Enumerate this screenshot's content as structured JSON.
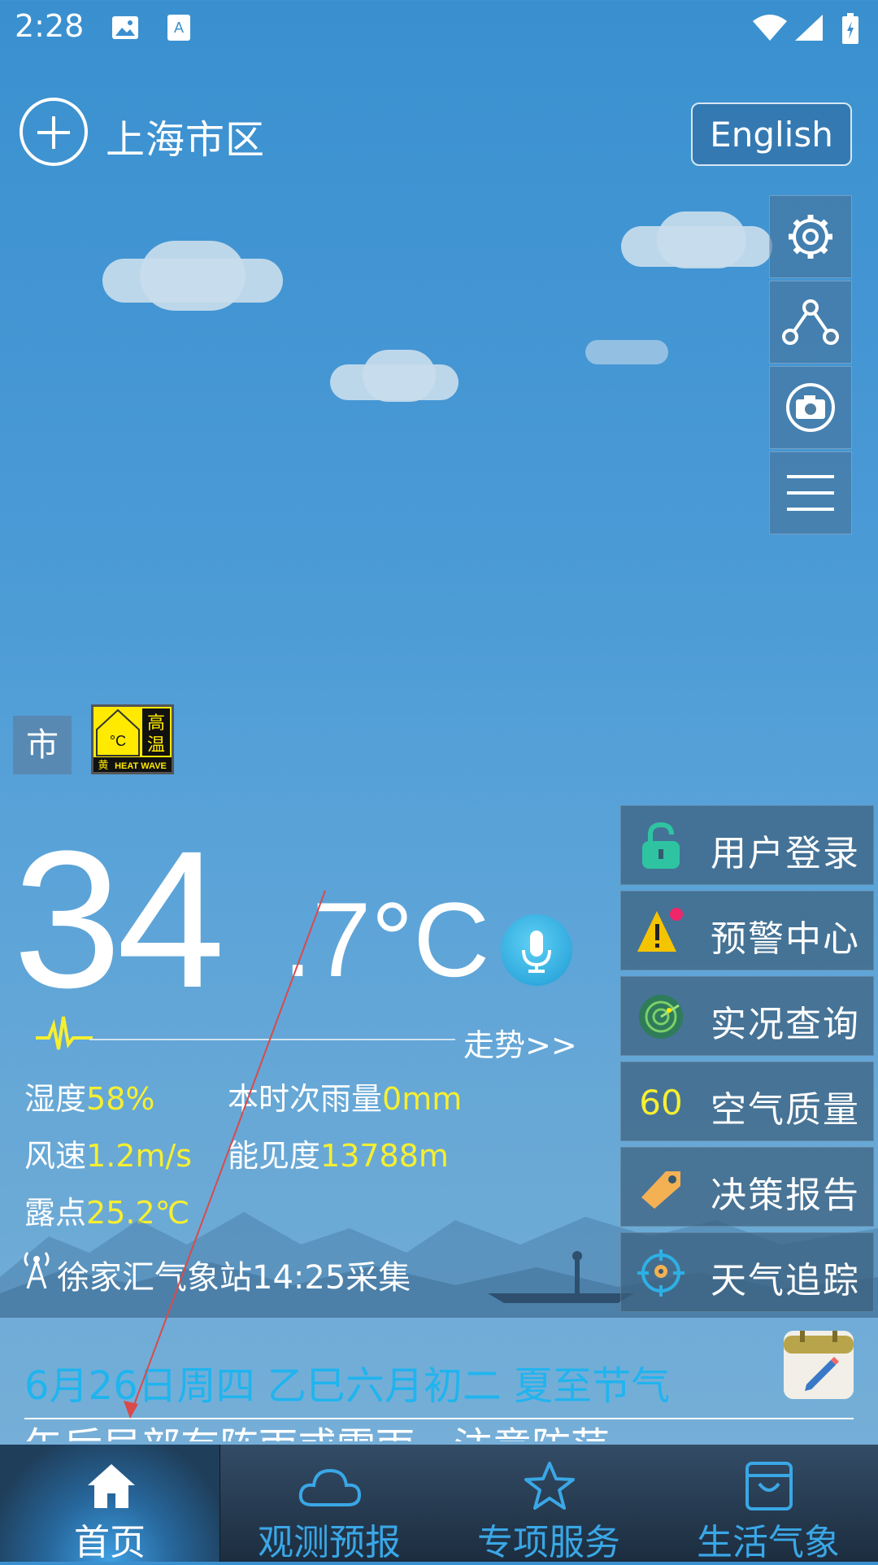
{
  "status_bar": {
    "time": "2:28"
  },
  "header": {
    "city": "上海市区",
    "language_button": "English"
  },
  "tools": [
    {
      "icon": "gear-icon"
    },
    {
      "icon": "share-icon"
    },
    {
      "icon": "camera-icon"
    },
    {
      "icon": "menu-icon"
    }
  ],
  "warning": {
    "scope": "市",
    "badge_level": "黄",
    "badge_title": "高温",
    "badge_en": "HEAT WAVE",
    "badge_unit": "°C"
  },
  "temperature": {
    "integer": "34",
    "decimal": ".7",
    "unit": "°C"
  },
  "trend_link": "走势>>",
  "observations": {
    "humidity_label": "湿度",
    "humidity_value": "58%",
    "rain_label": "本时次雨量",
    "rain_value": "0mm",
    "wind_label": "风速",
    "wind_value": "1.2m/s",
    "visibility_label": "能见度",
    "visibility_value": "13788m",
    "dew_label": "露点",
    "dew_value": "25.2℃"
  },
  "station": "徐家汇气象站14:25采集",
  "menu": [
    {
      "label": "用户登录",
      "icon": "lock-icon"
    },
    {
      "label": "预警中心",
      "icon": "warning-icon"
    },
    {
      "label": "实况查询",
      "icon": "radar-icon"
    },
    {
      "label": "空气质量",
      "icon": "aqi-value",
      "value": "60"
    },
    {
      "label": "决策报告",
      "icon": "tag-icon"
    },
    {
      "label": "天气追踪",
      "icon": "target-icon"
    }
  ],
  "date_line": "6月26日周四  乙巳六月初二  夏至节气",
  "scroll_text": "午后局部有阵雨或雷雨，注意防范",
  "bottom_nav": [
    {
      "label": "首页",
      "icon": "home-icon",
      "active": true
    },
    {
      "label": "观测预报",
      "icon": "cloud-icon"
    },
    {
      "label": "专项服务",
      "icon": "star-icon"
    },
    {
      "label": "生活气象",
      "icon": "shopping-bag-icon"
    }
  ],
  "colors": {
    "accent_yellow": "#f6ef31",
    "date_blue": "#20b4ee",
    "nav_blue": "#3aa7e6"
  }
}
